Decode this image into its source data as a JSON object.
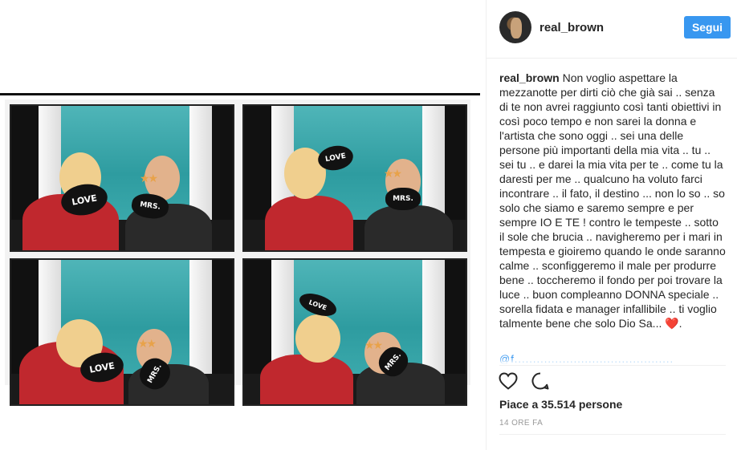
{
  "post": {
    "photo_signs": {
      "love": "LOVE",
      "mrs": "MRS."
    }
  },
  "header": {
    "username": "real_brown",
    "follow_label": "Segui"
  },
  "caption": {
    "username": "real_brown",
    "text": "Non voglio aspettare la mezzanotte per dirti ciò che già sai .. senza di te non avrei raggiunto così tanti obiettivi in così poco tempo e non sarei la donna e l'artista che sono oggi .. sei una delle persone più importanti della mia vita .. tu .. sei tu .. e darei la mia vita per te .. come tu la daresti per me .. qualcuno ha voluto farci incontrare .. il fato, il destino ... non lo so .. so solo che siamo e saremo sempre e per sempre IO E TE ! contro le tempeste .. sotto il sole che brucia .. navigheremo per i mari in tempesta e gioiremo quando le onde saranno calme .. sconfiggeremo il male per produrre bene .. toccheremo il fondo per poi trovare la luce .. buon compleanno DONNA speciale .. sorella fidata e manager infallibile .. ti voglio talmente bene che solo Dio Sa... ❤️.",
    "truncated_line": "@f..........................................."
  },
  "actions": {
    "like_icon": "heart-outline-icon",
    "comment_icon": "comment-bubble-icon"
  },
  "likes_text": "Piace a 35.514 persone",
  "timestamp": "14 ORE FA",
  "colors": {
    "accent": "#3897f0",
    "text": "#262626",
    "muted": "#999999",
    "backdrop": "#3aa8ab"
  }
}
